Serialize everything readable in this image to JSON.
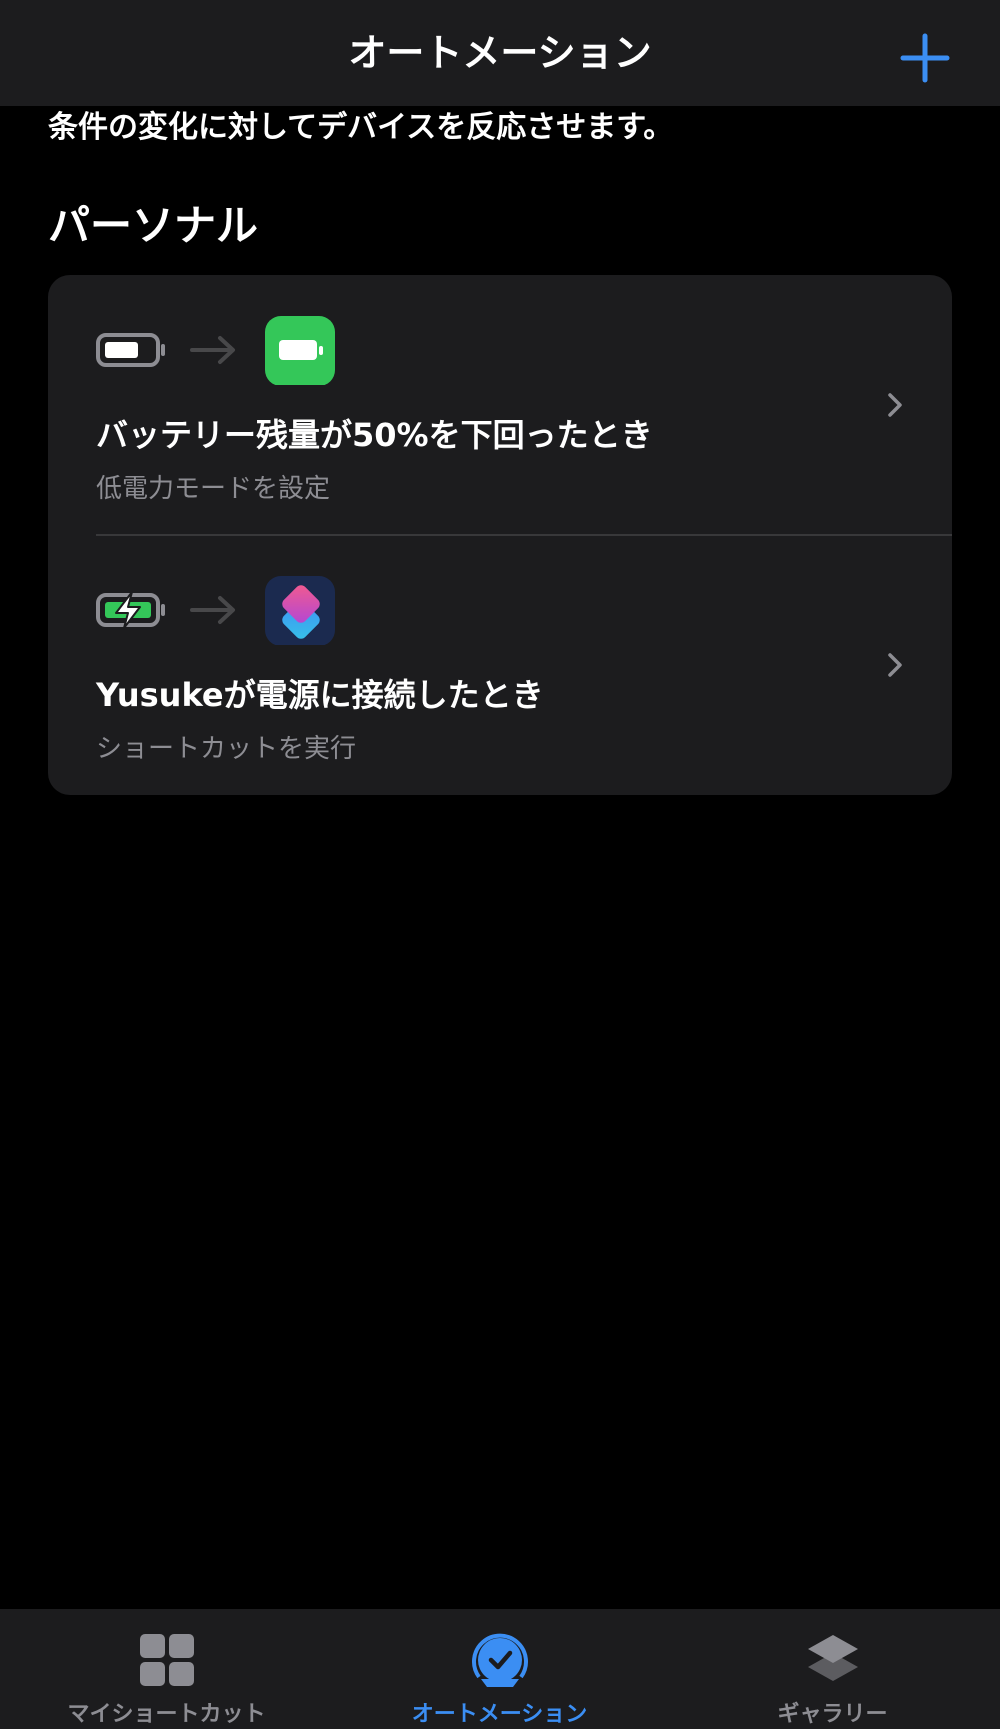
{
  "nav": {
    "title": "オートメーション",
    "add_icon": "plus-icon"
  },
  "header": {
    "subtitle": "条件の変化に対してデバイスを反応させます。",
    "section_title": "パーソナル"
  },
  "automations": [
    {
      "title": "バッテリー残量が50%を下回ったとき",
      "subtitle": "低電力モードを設定",
      "trigger_icon": "battery-icon",
      "action_icon": "low-power-mode-icon"
    },
    {
      "title": "Yusukeが電源に接続したとき",
      "subtitle": "ショートカットを実行",
      "trigger_icon": "battery-charging-icon",
      "action_icon": "shortcuts-app-icon"
    }
  ],
  "tabs": [
    {
      "label": "マイショートカット",
      "icon": "grid-icon",
      "active": false
    },
    {
      "label": "オートメーション",
      "icon": "automation-check-icon",
      "active": true
    },
    {
      "label": "ギャラリー",
      "icon": "layers-icon",
      "active": false
    }
  ],
  "colors": {
    "accent": "#3b8ef3",
    "background": "#000000",
    "card": "#1c1c1e",
    "secondary_text": "#8d8d93",
    "battery_green": "#34c759"
  }
}
